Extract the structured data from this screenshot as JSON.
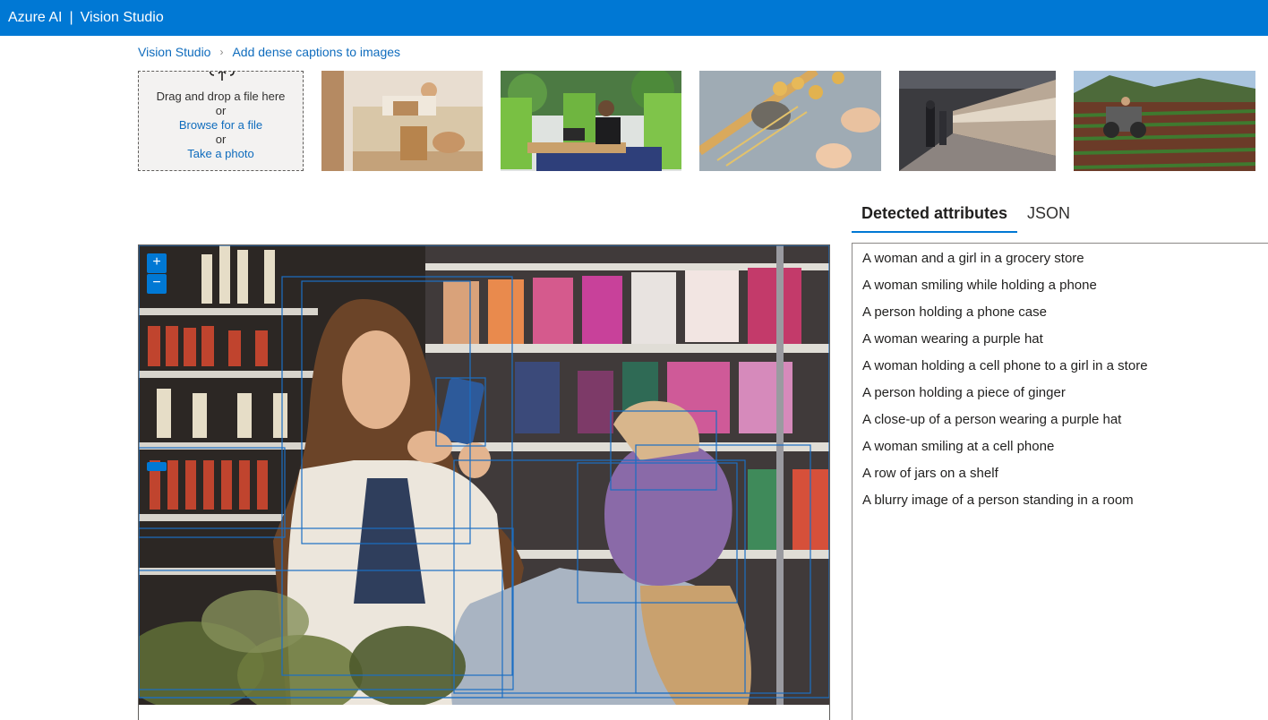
{
  "topbar": {
    "brand": "Azure AI",
    "separator": "|",
    "product": "Vision Studio"
  },
  "breadcrumb": {
    "root": "Vision Studio",
    "current": "Add dense captions to images"
  },
  "upload": {
    "icon": "cloud-upload-icon",
    "drag_text": "Drag and drop a file here",
    "or1": "or",
    "browse_link": "Browse for a file",
    "or2": "or",
    "photo_link": "Take a photo"
  },
  "thumbnails": [
    "woman-with-dog-on-couch-image",
    "woman-at-laptop-in-office-image",
    "pasta-making-image",
    "subway-platform-image",
    "farmer-on-tractor-image"
  ],
  "tabs": [
    "Detected attributes",
    "JSON"
  ],
  "active_tab": "Detected attributes",
  "zoom": {
    "in_label": "+",
    "out_label": "−"
  },
  "captions": [
    "A woman and a girl in a grocery store",
    "A woman smiling while holding a phone",
    "A person holding a phone case",
    "A woman wearing a purple hat",
    "A woman holding a cell phone to a girl in a store",
    "A person holding a piece of ginger",
    "A close-up of a person wearing a purple hat",
    "A woman smiling at a cell phone",
    "A row of jars on a shelf",
    "A blurry image of a person standing in a room"
  ],
  "colors": {
    "accent": "#0078d4",
    "box": "#1b6fc4",
    "link": "#0f6cbd"
  }
}
